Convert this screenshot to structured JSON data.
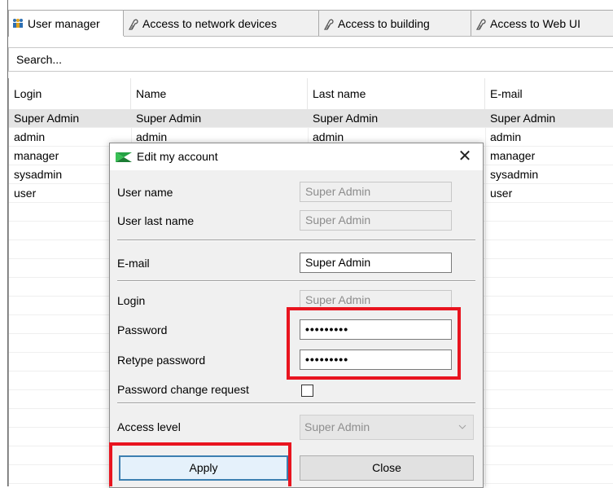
{
  "tabs": [
    {
      "label": "User manager",
      "icon": "users-icon"
    },
    {
      "label": "Access to network devices",
      "icon": "access-icon"
    },
    {
      "label": "Access to building",
      "icon": "access-icon"
    },
    {
      "label": "Access to Web UI",
      "icon": "access-icon"
    }
  ],
  "search": {
    "placeholder": "Search..."
  },
  "table": {
    "columns": [
      "Login",
      "Name",
      "Last name",
      "E-mail"
    ],
    "rows": [
      [
        "Super Admin",
        "Super Admin",
        "Super Admin",
        "Super Admin"
      ],
      [
        "admin",
        "admin",
        "admin",
        "admin"
      ],
      [
        "manager",
        "manager",
        "manager",
        "manager"
      ],
      [
        "sysadmin",
        "sysadmin",
        "sysadmin",
        "sysadmin"
      ],
      [
        "user",
        "user",
        "user",
        "user"
      ]
    ],
    "selected_row": 0
  },
  "dialog": {
    "title": "Edit my account",
    "close_glyph": "✕",
    "user_name_label": "User name",
    "user_name_value": "Super Admin",
    "user_last_name_label": "User last name",
    "user_last_name_value": "Super Admin",
    "email_label": "E-mail",
    "email_value": "Super Admin",
    "login_label": "Login",
    "login_value": "Super Admin",
    "password_label": "Password",
    "password_value": "•••••••••",
    "retype_password_label": "Retype password",
    "retype_password_value": "•••••••••",
    "password_change_label": "Password change request",
    "password_change_checked": false,
    "access_level_label": "Access level",
    "access_level_value": "Super Admin",
    "apply_label": "Apply",
    "close_label": "Close"
  },
  "colors": {
    "highlight": "#e8141f",
    "selected_row": "#e4e4e4",
    "primary_border": "#3c7fb1"
  }
}
